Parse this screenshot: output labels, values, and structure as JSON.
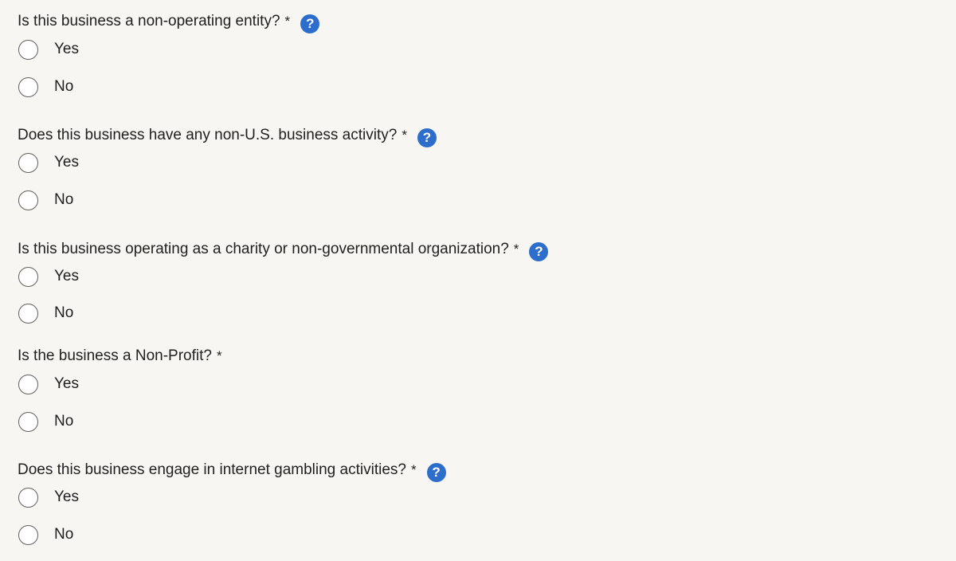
{
  "form": {
    "questions": [
      {
        "label": "Is this business a non-operating entity?",
        "required_mark": "*",
        "help_icon": "?",
        "options": [
          "Yes",
          "No"
        ]
      },
      {
        "label": "Does this business have any non-U.S. business activity?",
        "required_mark": "*",
        "help_icon": "?",
        "options": [
          "Yes",
          "No"
        ]
      },
      {
        "label": "Is this business operating as a charity or non-governmental organization?",
        "required_mark": "*",
        "help_icon": "?",
        "options": [
          "Yes",
          "No"
        ]
      },
      {
        "label": "Is the business a Non-Profit?",
        "required_mark": "*",
        "options": [
          "Yes",
          "No"
        ]
      },
      {
        "label": "Does this business engage in internet gambling activities?",
        "required_mark": "*",
        "help_icon": "?",
        "options": [
          "Yes",
          "No"
        ]
      }
    ]
  },
  "colors": {
    "background": "#f8f6f3",
    "help_icon": "#2d6dcc",
    "text": "#1f1f1f"
  }
}
